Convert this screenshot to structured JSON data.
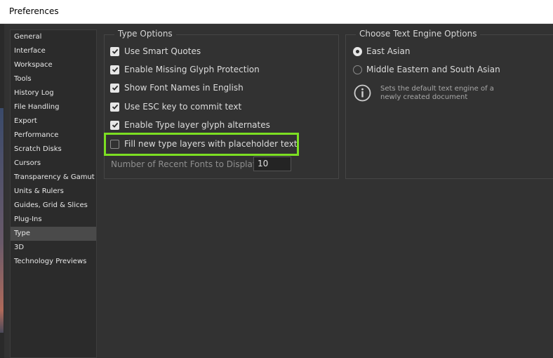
{
  "window": {
    "title": "Preferences"
  },
  "sidebar": {
    "items": [
      {
        "label": "General"
      },
      {
        "label": "Interface"
      },
      {
        "label": "Workspace"
      },
      {
        "label": "Tools"
      },
      {
        "label": "History Log"
      },
      {
        "label": "File Handling"
      },
      {
        "label": "Export"
      },
      {
        "label": "Performance"
      },
      {
        "label": "Scratch Disks"
      },
      {
        "label": "Cursors"
      },
      {
        "label": "Transparency & Gamut"
      },
      {
        "label": "Units & Rulers"
      },
      {
        "label": "Guides, Grid & Slices"
      },
      {
        "label": "Plug-Ins"
      },
      {
        "label": "Type"
      },
      {
        "label": "3D"
      },
      {
        "label": "Technology Previews"
      }
    ],
    "selected": "Type"
  },
  "type_options": {
    "legend": "Type Options",
    "checkboxes": [
      {
        "label": "Use Smart Quotes",
        "checked": true
      },
      {
        "label": "Enable Missing Glyph Protection",
        "checked": true
      },
      {
        "label": "Show Font Names in English",
        "checked": true
      },
      {
        "label": "Use ESC key to commit text",
        "checked": true
      },
      {
        "label": "Enable Type layer glyph alternates",
        "checked": true
      },
      {
        "label": "Fill new type layers with placeholder text",
        "checked": false
      }
    ],
    "recent_fonts_label": "Number of Recent Fonts to Display:",
    "recent_fonts_value": "10"
  },
  "text_engine": {
    "legend": "Choose Text Engine Options",
    "radios": [
      {
        "label": "East Asian",
        "selected": true
      },
      {
        "label": "Middle Eastern and South Asian",
        "selected": false
      }
    ],
    "info_text": "Sets the default text engine of a newly created document"
  },
  "colors": {
    "background": "#323232",
    "highlight": "#7cdf22"
  }
}
